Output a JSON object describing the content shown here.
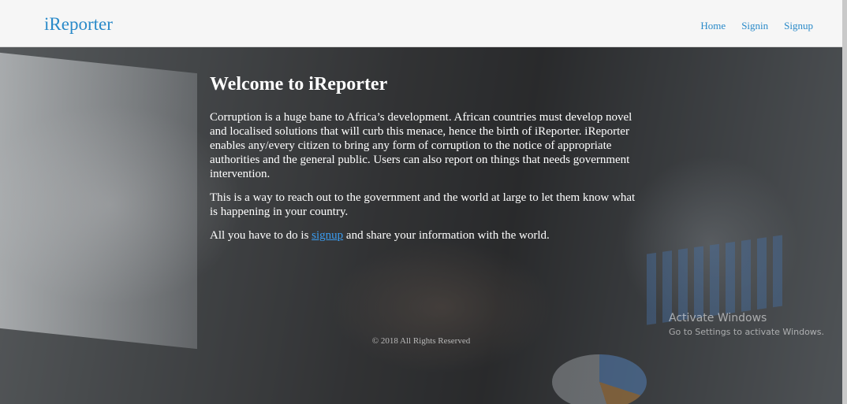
{
  "navbar": {
    "brand": "iReporter",
    "links": [
      "Home",
      "Signin",
      "Signup"
    ]
  },
  "hero": {
    "title": "Welcome to iReporter",
    "paragraph1": "Corruption is a huge bane to Africa’s development. African countries must develop novel and localised solutions that will curb this menace, hence the birth of iReporter. iReporter enables any/every citizen to bring any form of corruption to the notice of appropriate authorities and the general public. Users can also report on things that needs government intervention.",
    "paragraph2": "This is a way to reach out to the government and the world at large to let them know what is happening in your country.",
    "paragraph3_before": "All you have to do is ",
    "paragraph3_link": "signup",
    "paragraph3_after": " and share your information with the world."
  },
  "footer": {
    "copyright": "© 2018 All Rights Reserved"
  },
  "windows_watermark": {
    "title": "Activate Windows",
    "subtitle": "Go to Settings to activate Windows."
  },
  "colors": {
    "brand": "#2a8ac9",
    "link": "#3b9cf0",
    "navbar_bg": "#f6f6f6"
  }
}
